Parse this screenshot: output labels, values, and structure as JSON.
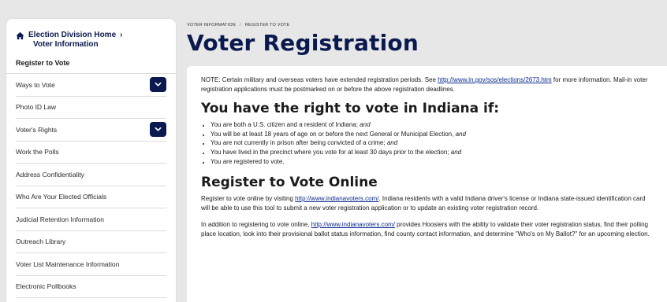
{
  "sidebar": {
    "home_label": "Election Division Home",
    "home_chevron": "›",
    "home_sub": "Voter Information",
    "current": "Register to Vote",
    "items": [
      {
        "label": "Ways to Vote",
        "expandable": true
      },
      {
        "label": "Photo ID Law",
        "expandable": false
      },
      {
        "label": "Voter's Rights",
        "expandable": true
      },
      {
        "label": "Work the Polls",
        "expandable": false
      },
      {
        "label": "Address Confidentiality",
        "expandable": false
      },
      {
        "label": "Who Are Your Elected Officials",
        "expandable": false
      },
      {
        "label": "Judicial Retention Information",
        "expandable": false
      },
      {
        "label": "Outreach Library",
        "expandable": false
      },
      {
        "label": "Voter List Maintenance Information",
        "expandable": false
      },
      {
        "label": "Electronic Pollbooks",
        "expandable": false
      }
    ]
  },
  "breadcrumb": {
    "items": [
      "Voter Information",
      "Register to Vote"
    ],
    "separator": "/"
  },
  "page_title": "Voter Registration",
  "note": {
    "before": "NOTE: Certain military and overseas voters have extended registration periods. See ",
    "link": "http://www.in.gov/sos/elections/2673.htm",
    "after": " for more information. Mail-in voter registration applications must be postmarked on or before the above registration deadlines."
  },
  "rights": {
    "heading": "You have the right to vote in Indiana if:",
    "bullets": [
      {
        "text": "You are both a U.S. citizen and a resident of Indiana; ",
        "em": "and"
      },
      {
        "text": "You will be at least 18 years of age on or before the next General or Municipal Election, ",
        "em": "and"
      },
      {
        "text": "You are not currently in prison after being convicted of a crime; ",
        "em": "and"
      },
      {
        "text": "You have lived in the precinct where you vote for at least 30 days prior to the election; ",
        "em": "and"
      },
      {
        "text": "You are registered to vote.",
        "em": ""
      }
    ]
  },
  "register_online": {
    "heading": "Register to Vote Online",
    "p1_before": "Register to vote online by visiting ",
    "p1_link": "http://www.indianavoters.com/",
    "p1_after": ".  Indiana residents with a valid Indiana driver's license or Indiana state-issued identification card will be able to use this tool to submit a new voter registration application or to update an existing voter registration record.",
    "p2_before": "In addition to registering to vote online, ",
    "p2_link": "http://www.indianavoters.com/",
    "p2_after": " provides Hoosiers with the ability to validate their voter registration status, find their polling place location, look into their provisional ballot status information, find county contact information, and determine \"Who's on My Ballot?\" for an upcoming election."
  },
  "colors": {
    "brand_navy": "#0b1a4e",
    "link": "#0b2a8f",
    "page_bg": "#e7e7e7"
  },
  "icons": {
    "home": "home-icon",
    "expand": "chevron-down-icon"
  }
}
